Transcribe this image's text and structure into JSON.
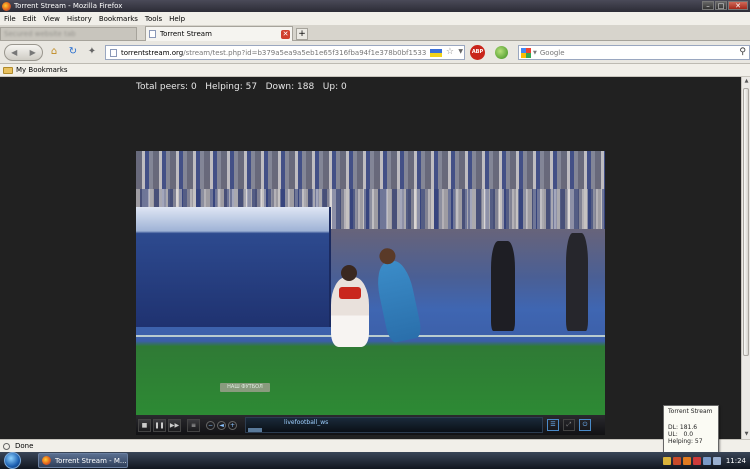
{
  "window": {
    "title": "Torrent Stream - Mozilla Firefox",
    "min": "–",
    "max": "□",
    "close": "✕"
  },
  "menu": [
    "File",
    "Edit",
    "View",
    "History",
    "Bookmarks",
    "Tools",
    "Help"
  ],
  "tabs": {
    "prev_label": "Secured website tab",
    "active_label": "Torrent Stream",
    "new_tab": "+"
  },
  "nav": {
    "url_host": "torrentstream.org",
    "url_path": "/stream/test.php?id=b379a5ea9a5eb1e65f316fba94f1e378b0bf1533",
    "search_placeholder": "Google",
    "abp": "ABP"
  },
  "bookmarks": {
    "folder": "My Bookmarks"
  },
  "stats": {
    "text": "Total peers: 0   Helping: 57   Down: 188   Up: 0"
  },
  "video": {
    "watermark": "НАШ ФУТБОЛ",
    "channel": "livefootball_ws",
    "controls": {
      "stop": "■",
      "pause": "❚❚",
      "next": "▶▶",
      "menu": "≡",
      "vol_down": "−",
      "vol": "◄",
      "vol_up": "+",
      "playlist": "☰",
      "fullscreen": "⤢",
      "power": "⏻"
    }
  },
  "statusbar": {
    "text": "Done"
  },
  "tooltip": {
    "title": "Torrent Stream",
    "dl": "DL: 181.6",
    "ul": "UL:   0.0",
    "helping": "Helping: 57"
  },
  "taskbar": {
    "task_label": "Torrent Stream - M...",
    "clock": "11:24"
  },
  "colors": {
    "content_bg": "#212121",
    "titlebar": "#2c2c36",
    "pitch": "#2d8a34"
  }
}
